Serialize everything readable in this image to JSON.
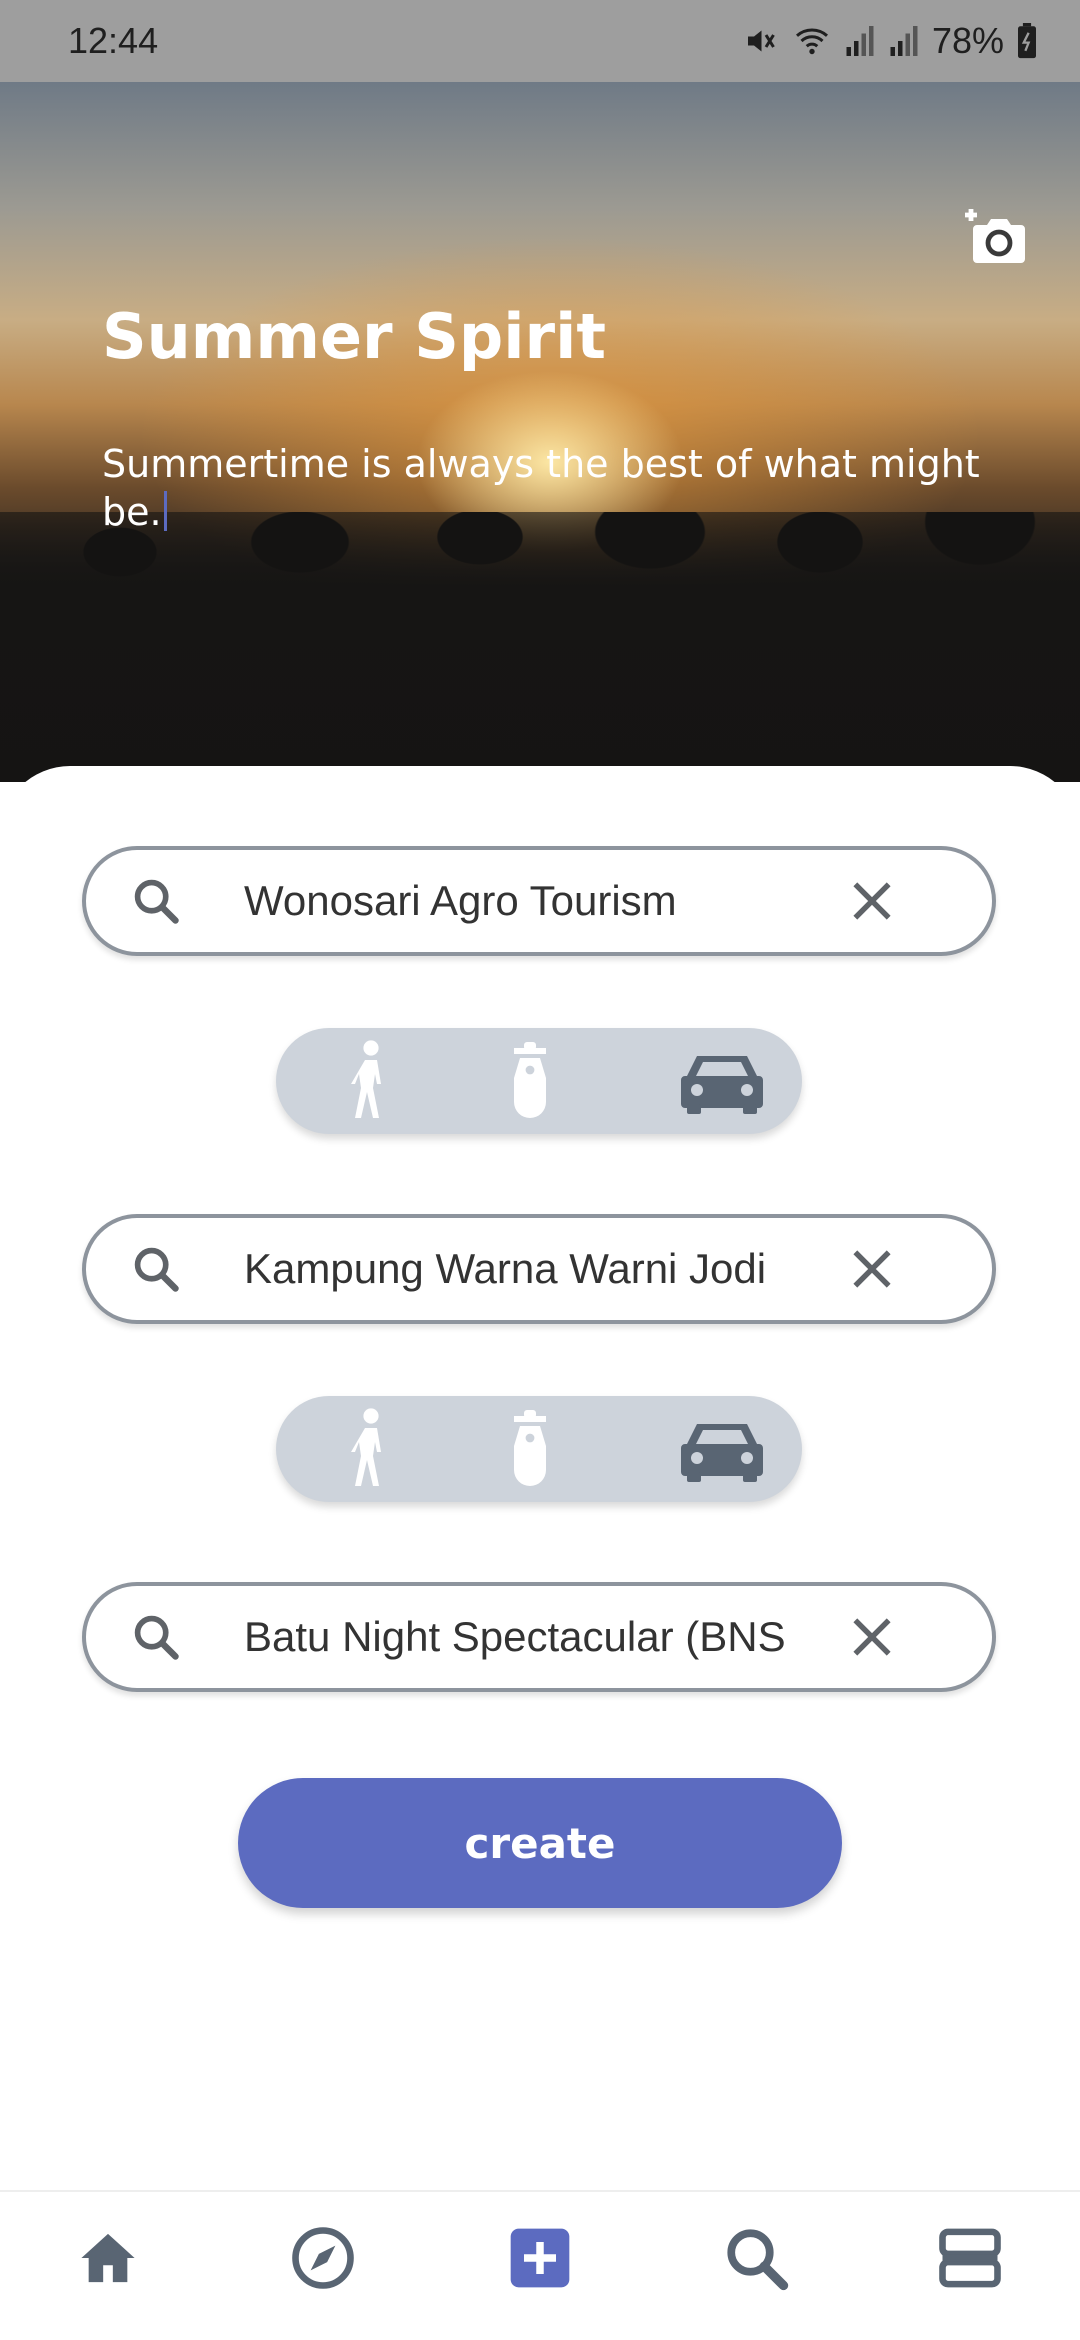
{
  "status_bar": {
    "time": "12:44",
    "battery": "78%",
    "icons": [
      "mute-icon",
      "wifi-icon",
      "signal-icon",
      "signal-icon",
      "battery-icon"
    ]
  },
  "hero": {
    "title": "Summer Spirit",
    "description": "Summertime is always the best of what might be.",
    "camera_icon": "add-photo-icon"
  },
  "destinations": [
    {
      "value": "Wonosari Agro Tourism"
    },
    {
      "value": "Kampung Warna Warni Jodi"
    },
    {
      "value": "Batu Night Spectacular (BNS"
    }
  ],
  "transport_modes": {
    "options": [
      "walk-icon",
      "scooter-icon",
      "car-icon"
    ],
    "selected": "car-icon"
  },
  "create_button": {
    "label": "create"
  },
  "bottom_nav": {
    "items": [
      "home-icon",
      "explore-icon",
      "add-icon",
      "search-icon",
      "trips-icon"
    ],
    "active": "add-icon"
  },
  "colors": {
    "accent": "#5c6bc0",
    "pill_bg": "#cdd3db",
    "icon_inactive": "#596573",
    "field_border": "#8d949d"
  }
}
